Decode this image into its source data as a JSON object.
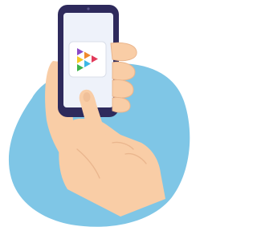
{
  "illustration": {
    "colors": {
      "blob": "#7FC6E6",
      "skin": "#F9CDA6",
      "skin_shadow": "#EAB68E",
      "phone_frame": "#2E2A5C",
      "phone_screen": "#EEF2FA",
      "app_tile": "#FFFFFF",
      "app_border": "#D9DEE8",
      "logo_red": "#E23A5A",
      "logo_orange": "#F08A2C",
      "logo_yellow": "#F5C823",
      "logo_blue": "#3CB7E6",
      "logo_purple": "#8B4BC7",
      "logo_green": "#3CB34A"
    },
    "icons": {
      "phone": "smartphone-icon",
      "app": "play-app-icon",
      "hand": "hand-icon"
    }
  }
}
